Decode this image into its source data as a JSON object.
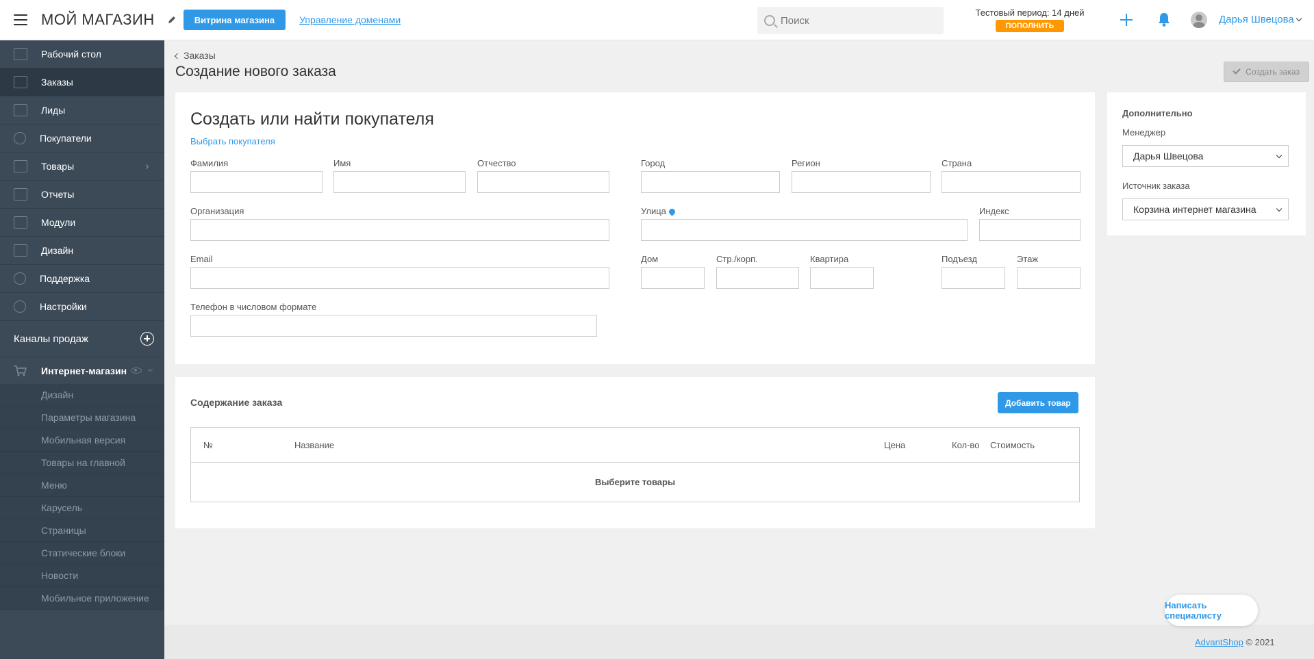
{
  "header": {
    "logo": "МОЙ МАГАЗИН",
    "storefront_button": "Витрина магазина",
    "domains_link": "Управление доменами",
    "search_placeholder": "Поиск",
    "trial_label": "Тестовый период:",
    "trial_days": "14 дней",
    "topup_button": "ПОПОЛНИТЬ",
    "user_name": "Дарья Швецова",
    "icons": [
      "menu-icon",
      "pencil-icon",
      "search-icon",
      "plus-icon",
      "bell-icon",
      "avatar"
    ]
  },
  "sidebar": {
    "items": [
      {
        "label": "Рабочий стол",
        "icon": "dashboard-icon"
      },
      {
        "label": "Заказы",
        "icon": "orders-icon",
        "active": true
      },
      {
        "label": "Лиды",
        "icon": "kanban-icon"
      },
      {
        "label": "Покупатели",
        "icon": "user-icon"
      },
      {
        "label": "Товары",
        "icon": "list-icon",
        "has_submenu": true
      },
      {
        "label": "Отчеты",
        "icon": "chart-icon"
      },
      {
        "label": "Модули",
        "icon": "modules-icon"
      },
      {
        "label": "Дизайн",
        "icon": "brush-icon"
      },
      {
        "label": "Поддержка",
        "icon": "help-icon"
      },
      {
        "label": "Настройки",
        "icon": "gear-icon"
      }
    ],
    "channels_title": "Каналы продаж",
    "shop": {
      "label": "Интернет-магазин",
      "icon": "cart-icon"
    },
    "shop_subitems": [
      "Дизайн",
      "Параметры магазина",
      "Мобильная версия",
      "Товары на главной",
      "Меню",
      "Карусель",
      "Страницы",
      "Статические блоки",
      "Новости",
      "Мобильное приложение"
    ]
  },
  "main": {
    "breadcrumb": "Заказы",
    "page_title": "Создание нового заказа",
    "create_button": "Создать заказ"
  },
  "customer": {
    "title": "Создать или найти покупателя",
    "select_link": "Выбрать покупателя",
    "fields": {
      "last_name": {
        "label": "Фамилия",
        "value": ""
      },
      "first_name": {
        "label": "Имя",
        "value": ""
      },
      "patronymic": {
        "label": "Отчество",
        "value": ""
      },
      "organization": {
        "label": "Организация",
        "value": ""
      },
      "email": {
        "label": "Email",
        "value": ""
      },
      "phone": {
        "label": "Телефон в числовом формате",
        "value": ""
      },
      "city": {
        "label": "Город",
        "value": ""
      },
      "region": {
        "label": "Регион",
        "value": ""
      },
      "country": {
        "label": "Страна",
        "value": ""
      },
      "street": {
        "label": "Улица",
        "value": ""
      },
      "zip": {
        "label": "Индекс",
        "value": ""
      },
      "house": {
        "label": "Дом",
        "value": ""
      },
      "building": {
        "label": "Стр./корп.",
        "value": ""
      },
      "apartment": {
        "label": "Квартира",
        "value": ""
      },
      "entrance": {
        "label": "Подъезд",
        "value": ""
      },
      "floor": {
        "label": "Этаж",
        "value": ""
      }
    }
  },
  "order": {
    "title": "Содержание заказа",
    "add_button": "Добавить товар",
    "columns": [
      "№",
      "Название",
      "Цена",
      "Кол-во",
      "Стоимость"
    ],
    "empty_text": "Выберите товары"
  },
  "extra": {
    "title": "Дополнительно",
    "manager_label": "Менеджер",
    "manager_value": "Дарья Швецова",
    "source_label": "Источник заказа",
    "source_value": "Корзина интернет магазина"
  },
  "footer": {
    "brand": "AdvantShop",
    "copyright": "© 2021"
  },
  "chat_button": "Написать специалисту",
  "colors": {
    "accent": "#2f99e8",
    "sidebar": "#3c4a58",
    "topup": "#ff9800"
  }
}
